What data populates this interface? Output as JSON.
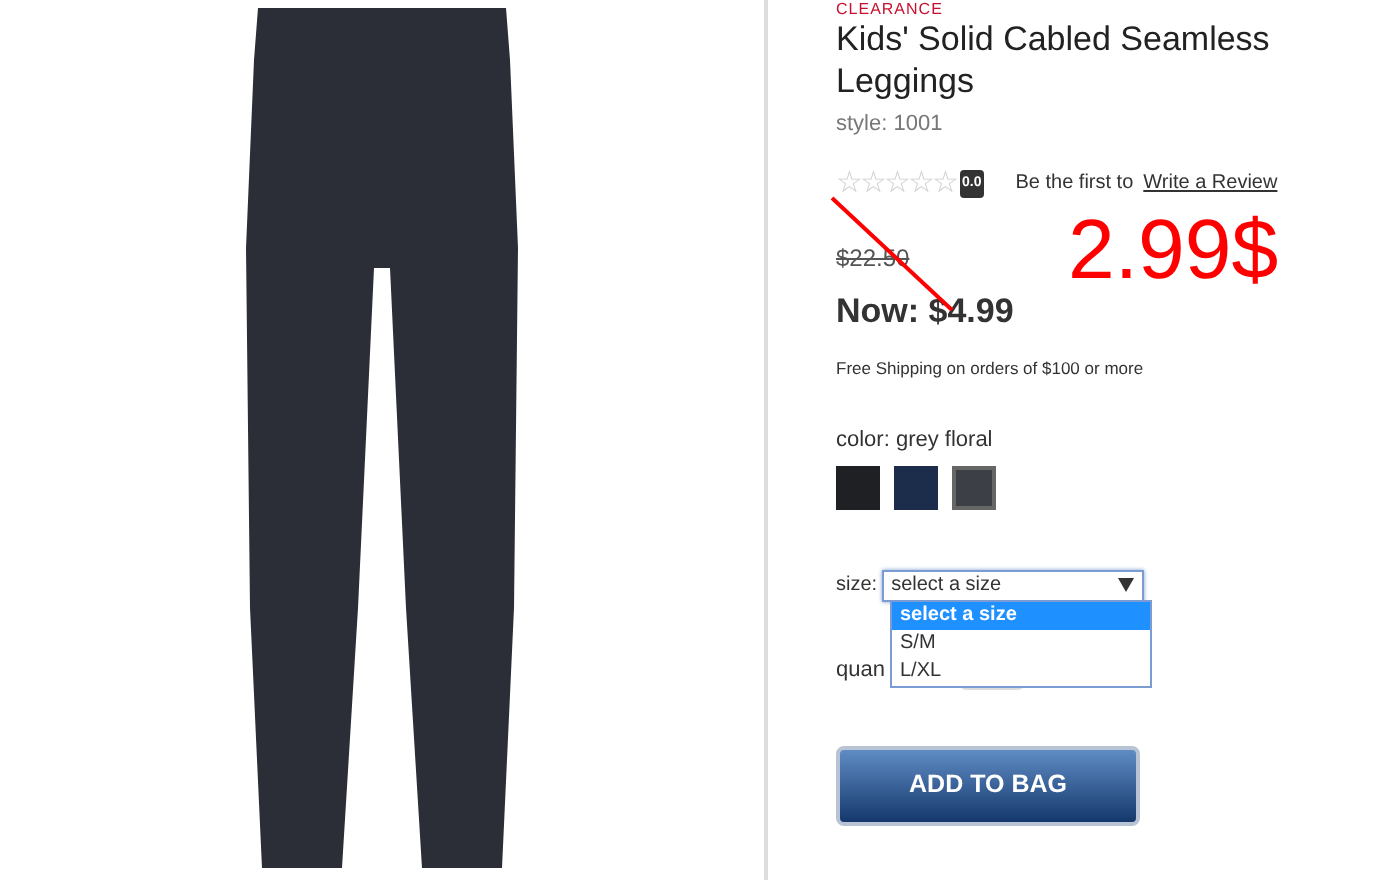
{
  "badge": "CLEARANCE",
  "title": "Kids' Solid Cabled Seamless Leggings",
  "style": "style: 1001",
  "rating": {
    "stars": 0,
    "score": "0.0",
    "prompt": "Be the first to",
    "link": "Write a Review"
  },
  "price": {
    "old": "$22.50",
    "now": "Now: $4.99"
  },
  "annotation": {
    "text": "2.99$"
  },
  "shipping": "Free Shipping on orders of $100 or more",
  "color": {
    "label": "color: grey floral",
    "swatches": [
      {
        "color": "#1e2024",
        "selected": false
      },
      {
        "color": "#1c2d4c",
        "selected": false
      },
      {
        "color": "#3d3f47",
        "selected": true
      }
    ]
  },
  "size": {
    "label": "size:",
    "value": "select a size",
    "expanded": true,
    "options": [
      {
        "label": "select a size",
        "selected": true
      },
      {
        "label": "S/M",
        "selected": false
      },
      {
        "label": "L/XL",
        "selected": false
      }
    ]
  },
  "quantity": {
    "label": "quan"
  },
  "add_button": "ADD TO BAG"
}
